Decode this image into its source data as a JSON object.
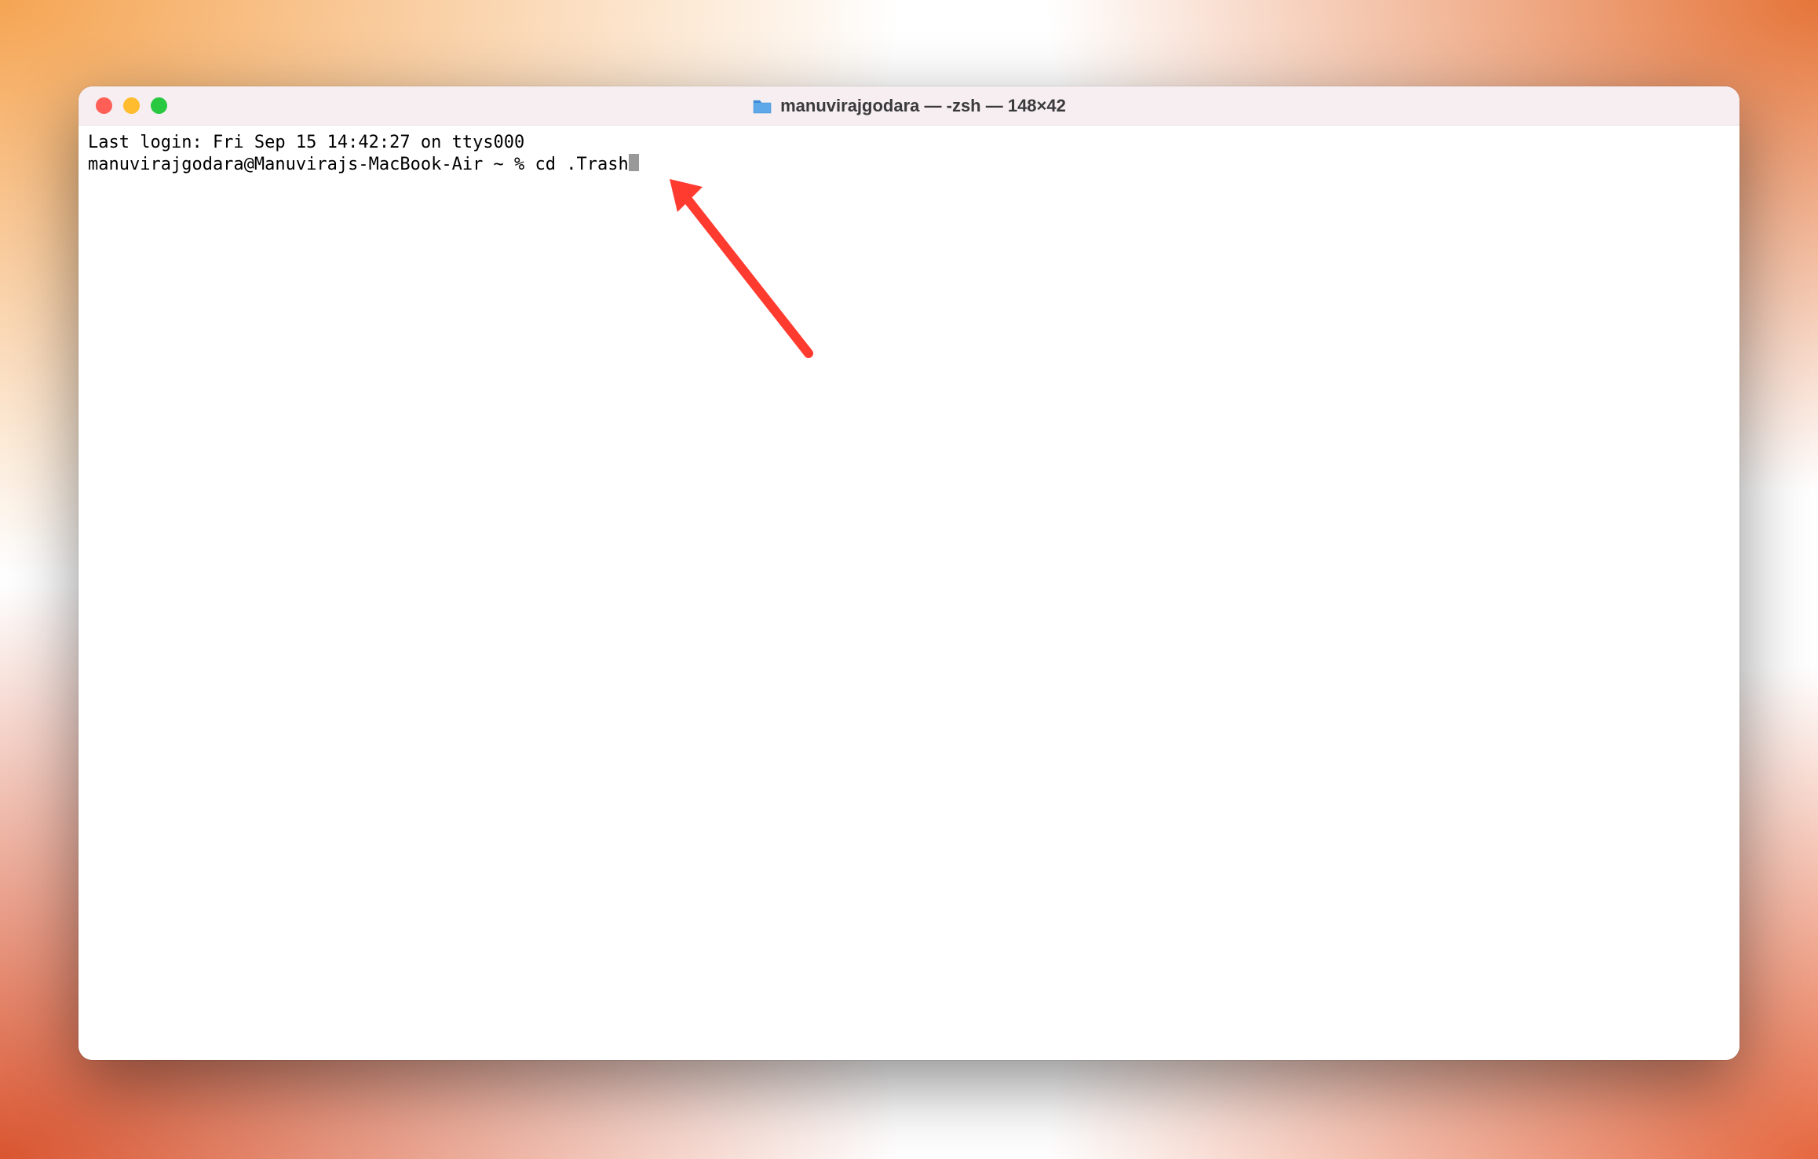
{
  "window": {
    "title": "manuvirajgodara — -zsh — 148×42"
  },
  "terminal": {
    "last_login_line": "Last login: Fri Sep 15 14:42:27 on ttys000",
    "prompt": "manuvirajgodara@Manuvirajs-MacBook-Air ~ % ",
    "command": "cd .Trash"
  },
  "icons": {
    "folder": "folder-icon"
  },
  "traffic_lights": {
    "close": "close",
    "minimize": "minimize",
    "maximize": "maximize"
  }
}
